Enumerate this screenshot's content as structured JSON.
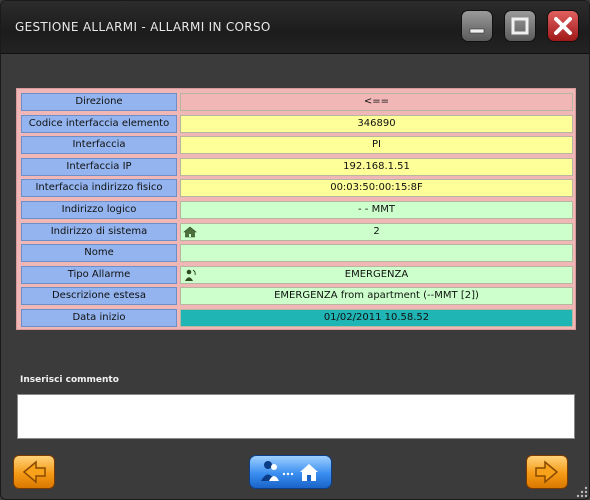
{
  "window": {
    "title": "GESTIONE ALLARMI - ALLARMI IN CORSO"
  },
  "colors": {
    "pink": "#f1b7b7",
    "yellow": "#ffff99",
    "green": "#ccffcc",
    "teal": "#1fb5b5",
    "label_blue": "#93b4ee"
  },
  "fields": [
    {
      "label": "Direzione",
      "value": "<==",
      "bg": "#f1b7b7"
    },
    {
      "label": "Codice interfaccia elemento",
      "value": "346890",
      "bg": "#ffff99"
    },
    {
      "label": "Interfaccia",
      "value": "PI",
      "bg": "#ffff99"
    },
    {
      "label": "Interfaccia IP",
      "value": "192.168.1.51",
      "bg": "#ffff99"
    },
    {
      "label": "Interfaccia indirizzo fisico",
      "value": "00:03:50:00:15:8F",
      "bg": "#ffff99"
    },
    {
      "label": "Indirizzo logico",
      "value": "-  - MMT",
      "bg": "#ccffcc"
    },
    {
      "label": "Indirizzo di sistema",
      "value": "2",
      "bg": "#ccffcc",
      "icon": "home-icon"
    },
    {
      "label": "Nome",
      "value": "",
      "bg": "#ccffcc"
    },
    {
      "label": "Tipo Allarme",
      "value": "EMERGENZA",
      "bg": "#ccffcc",
      "icon": "alarm-person-icon"
    },
    {
      "label": "Descrizione estesa",
      "value": "EMERGENZA from  apartment (--MMT [2])",
      "bg": "#ccffcc"
    },
    {
      "label": "Data inizio",
      "value": "01/02/2011 10.58.52",
      "bg": "#1fb5b5"
    }
  ],
  "comment": {
    "label": "Inserisci commento",
    "value": ""
  },
  "icons": {
    "minimize": "minimize-icon",
    "maximize": "maximize-icon",
    "close": "close-icon",
    "back": "arrow-left-icon",
    "forward": "arrow-right-icon",
    "user_to_home": "user-to-home-icon"
  }
}
